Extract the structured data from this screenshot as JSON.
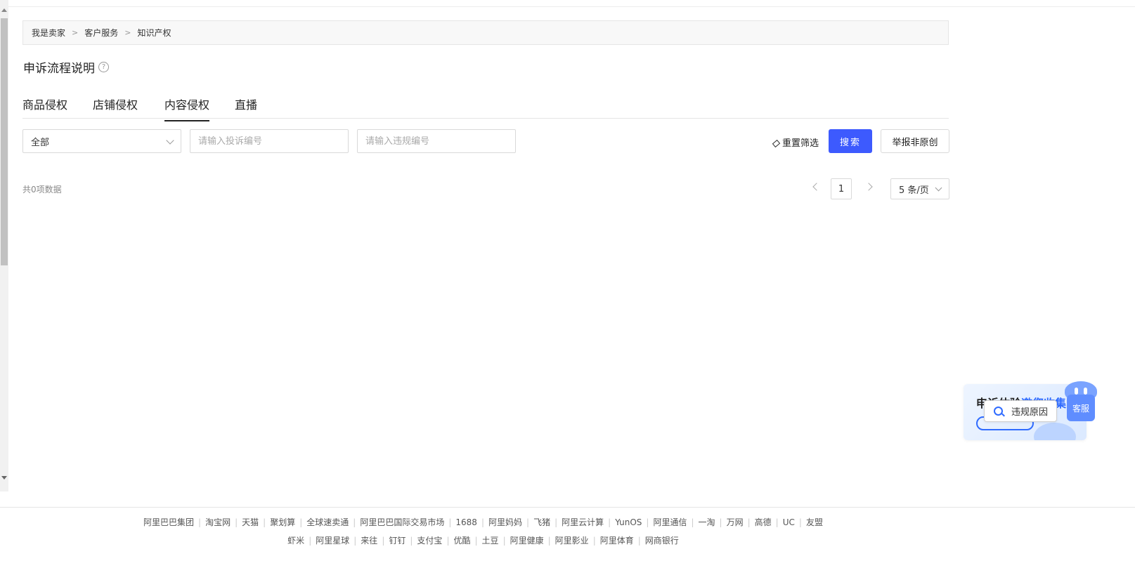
{
  "breadcrumb": [
    "我是卖家",
    "客户服务",
    "知识产权"
  ],
  "page_title": "申诉流程说明",
  "help_glyph": "?",
  "tabs": [
    {
      "label": "商品侵权",
      "active": false
    },
    {
      "label": "店铺侵权",
      "active": false
    },
    {
      "label": "内容侵权",
      "active": true
    },
    {
      "label": "直播",
      "active": false
    }
  ],
  "filters": {
    "category_select": "全部",
    "complaint_placeholder": "请输入投诉编号",
    "violation_placeholder": "请输入违规编号",
    "reset_label": "重置筛选",
    "search_label": "搜索",
    "report_label": "举报非原创"
  },
  "pagination": {
    "total_text": "共0项数据",
    "current_page": "1",
    "page_size": "5 条/页"
  },
  "float_widget": {
    "promo_dark": "申诉体验",
    "promo_blue": "邀您收集",
    "reason_label": "违规原因",
    "service_label": "客服"
  },
  "footer": {
    "row1": [
      "阿里巴巴集团",
      "淘宝网",
      "天猫",
      "聚划算",
      "全球速卖通",
      "阿里巴巴国际交易市场",
      "1688",
      "阿里妈妈",
      "飞猪",
      "阿里云计算",
      "YunOS",
      "阿里通信",
      "一淘",
      "万网",
      "高德",
      "UC",
      "友盟"
    ],
    "row2": [
      "虾米",
      "阿里星球",
      "来往",
      "钉钉",
      "支付宝",
      "优酷",
      "土豆",
      "阿里健康",
      "阿里影业",
      "阿里体育",
      "网商银行"
    ]
  },
  "colors": {
    "accent": "#3d5afe",
    "widget_blue": "#2f6bff"
  }
}
